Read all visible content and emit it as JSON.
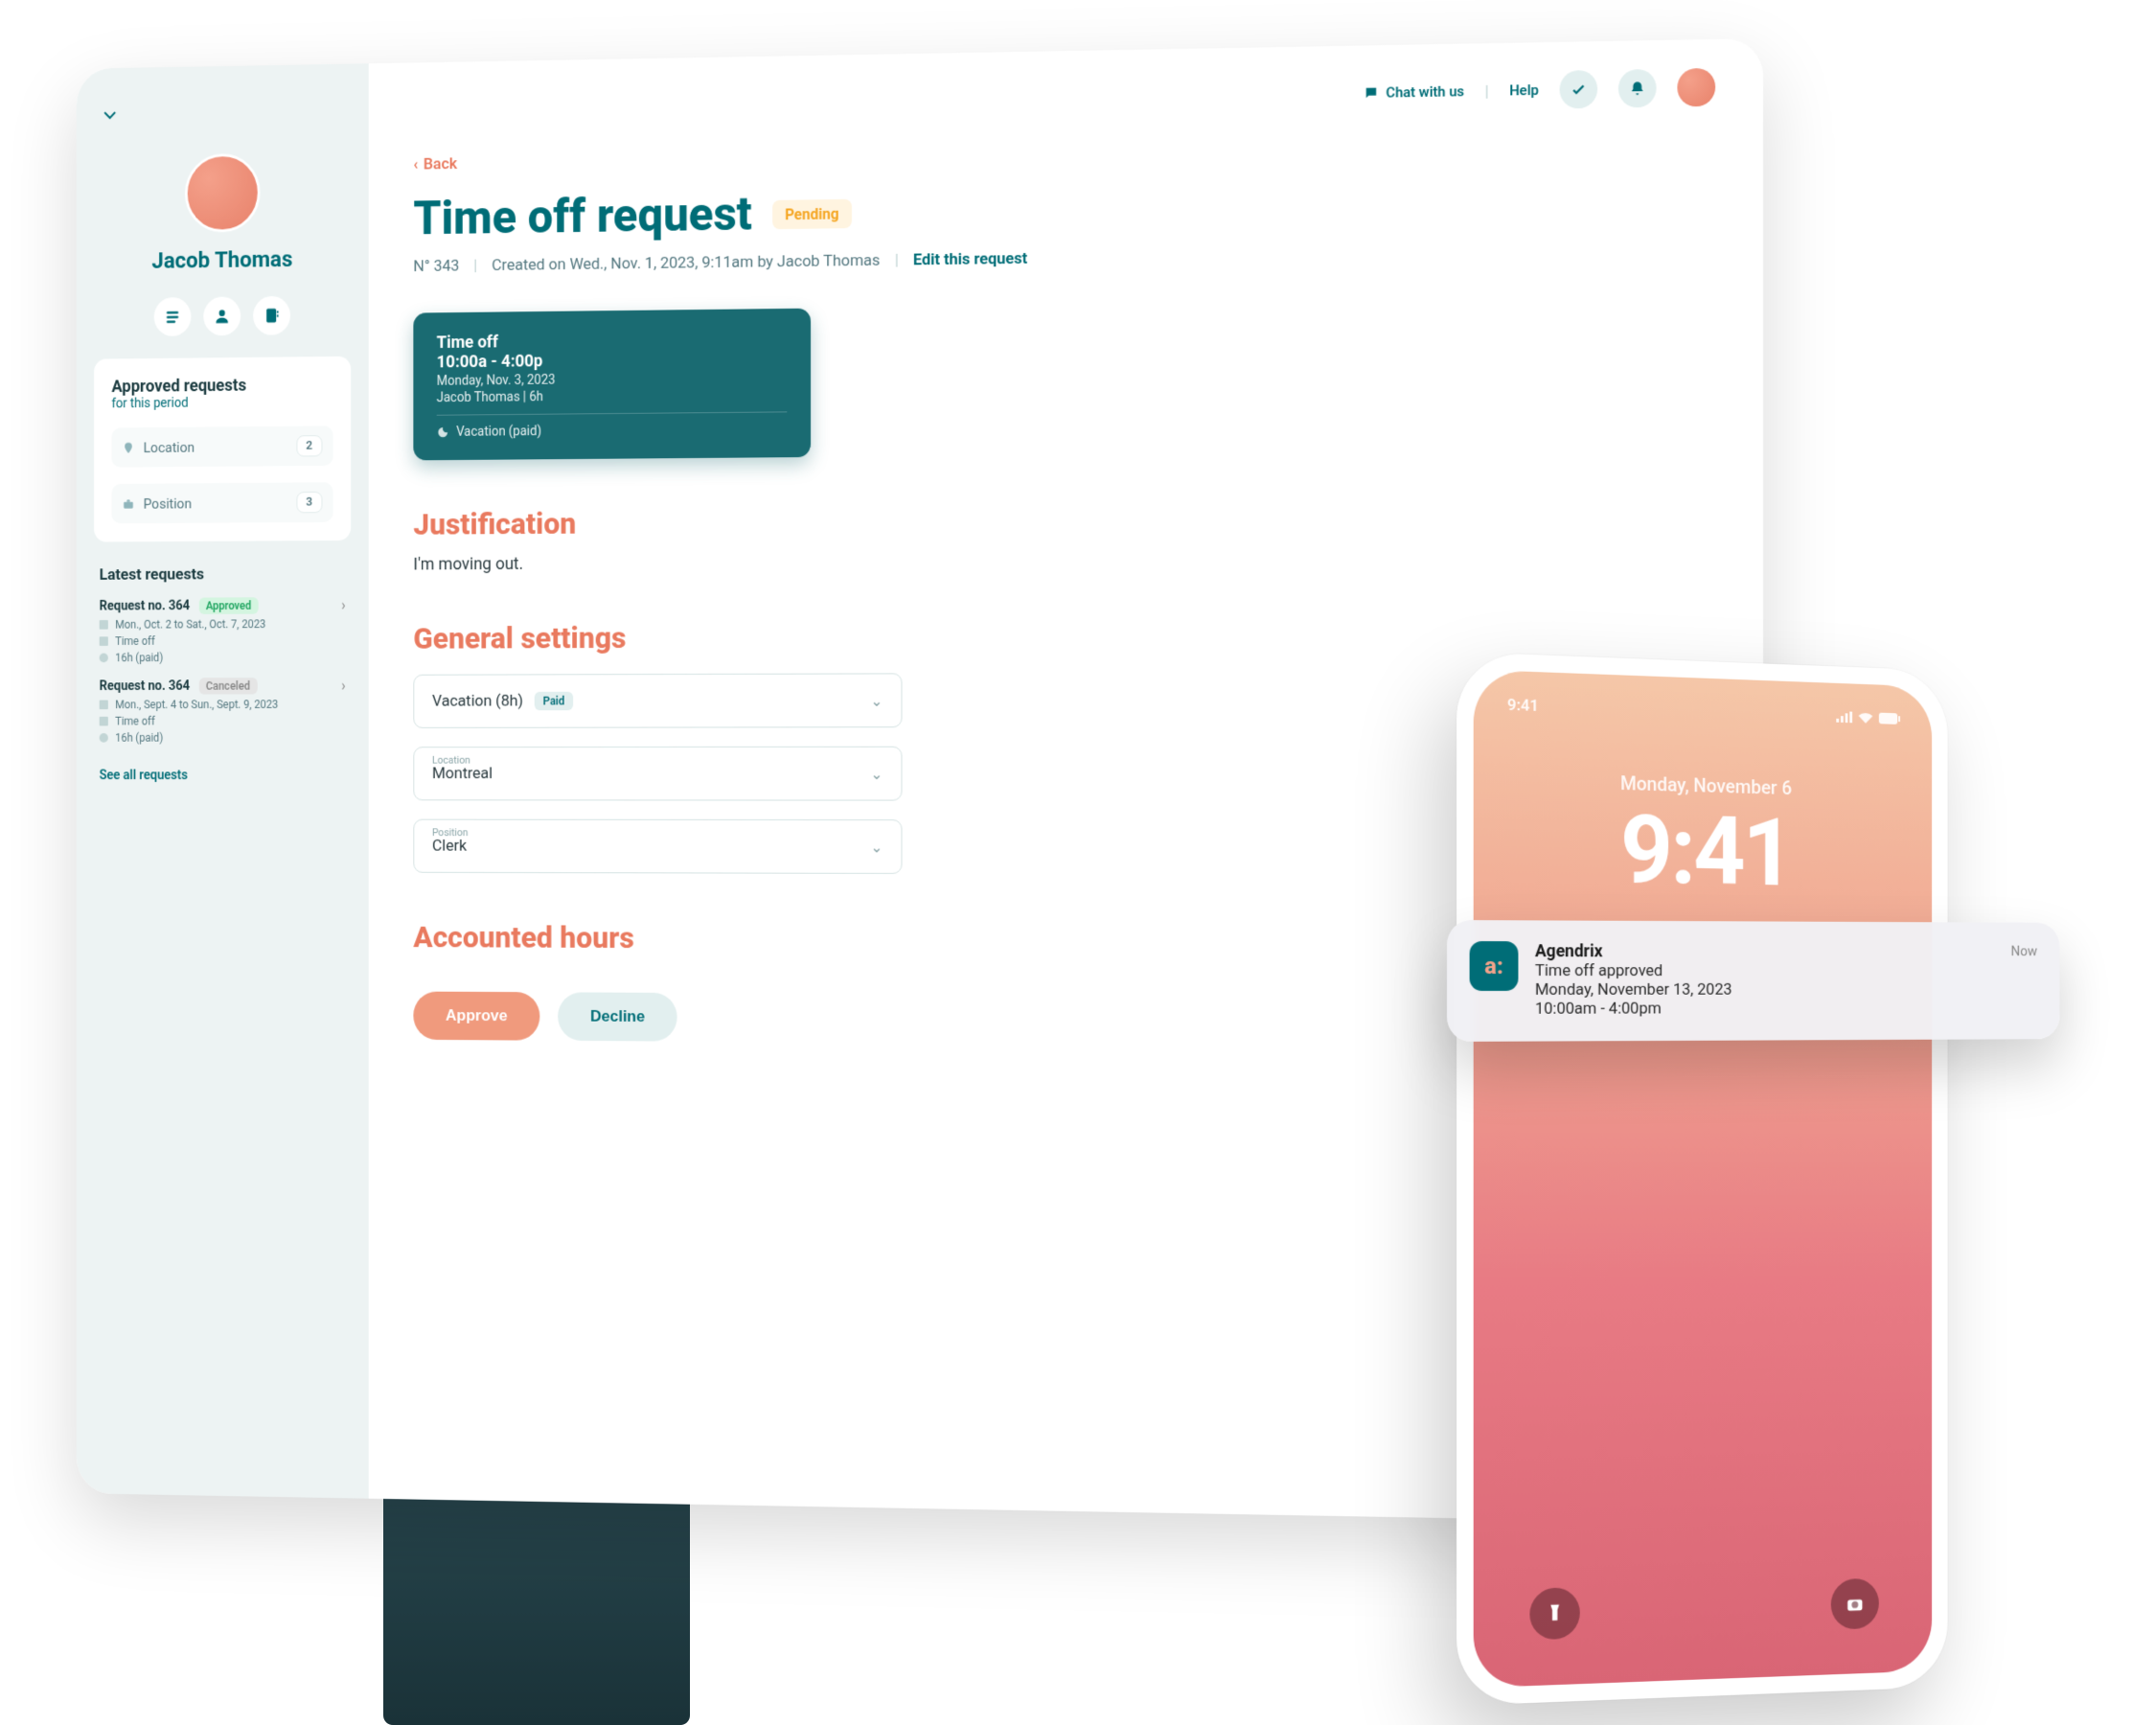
{
  "topbar": {
    "chat": "Chat with us",
    "help": "Help"
  },
  "sidebar": {
    "profile_name": "Jacob Thomas",
    "approved": {
      "title": "Approved requests",
      "subtitle": "for this period",
      "location_label": "Location",
      "location_count": "2",
      "position_label": "Position",
      "position_count": "3"
    },
    "latest": {
      "title": "Latest requests",
      "items": [
        {
          "no": "Request no. 364",
          "status": "Approved",
          "dates": "Mon., Oct. 2 to Sat., Oct. 7, 2023",
          "type": "Time off",
          "hours": "16h (paid)"
        },
        {
          "no": "Request no. 364",
          "status": "Canceled",
          "dates": "Mon., Sept. 4 to Sun., Sept. 9, 2023",
          "type": "Time off",
          "hours": "16h (paid)"
        }
      ],
      "see_all": "See all requests"
    }
  },
  "main": {
    "back": "Back",
    "title": "Time off request",
    "pending": "Pending",
    "req_no": "N° 343",
    "created": "Created on Wed., Nov. 1, 2023, 9:11am by Jacob Thomas",
    "edit": "Edit this request",
    "card": {
      "title": "Time off",
      "time": "10:00a - 4:00p",
      "date": "Monday, Nov. 3, 2023",
      "who": "Jacob Thomas   |   6h",
      "type": "Vacation (paid)"
    },
    "justification_h": "Justification",
    "justification_text": "I'm moving out.",
    "general_h": "General settings",
    "selects": {
      "type_val": "Vacation (8h)",
      "paid_tag": "Paid",
      "location_lbl": "Location",
      "location_val": "Montreal",
      "position_lbl": "Position",
      "position_val": "Clerk"
    },
    "accounted_h": "Accounted hours",
    "approve": "Approve",
    "decline": "Decline"
  },
  "phone": {
    "status_time": "9:41",
    "lock_date": "Monday, November 6",
    "lock_time": "9:41"
  },
  "notification": {
    "app": "Agendrix",
    "title": "Time off approved",
    "date": "Monday, November 13, 2023",
    "time_range": "10:00am - 4:00pm",
    "when": "Now"
  }
}
